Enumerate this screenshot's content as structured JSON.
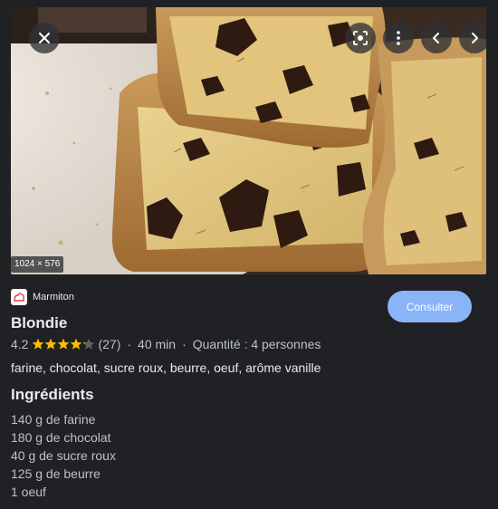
{
  "image": {
    "dimensions_label": "1024 × 576",
    "controls": {
      "close": "close-icon",
      "lens": "lens-search-icon",
      "more": "more-vertical-icon",
      "prev": "chevron-left-icon",
      "next": "chevron-right-icon"
    }
  },
  "source": {
    "name": "Marmiton",
    "logo": "marmiton-logo"
  },
  "consult_button": "Consulter",
  "recipe": {
    "title": "Blondie",
    "rating": "4.2",
    "rating_value": 4.2,
    "rating_max": 5,
    "reviews": "(27)",
    "separator": "·",
    "time": "40 min",
    "quantity": "Quantité : 4 personnes",
    "ingredients_summary": "farine, chocolat, sucre roux, beurre, oeuf, arôme vanille"
  },
  "ingredients_section": {
    "title": "Ingrédients",
    "items": [
      "140 g de farine",
      "180 g de chocolat",
      "40 g de sucre roux",
      "125 g de beurre",
      "1 oeuf"
    ]
  },
  "colors": {
    "background": "#202124",
    "accent_button": "#8ab4f8",
    "star": "#fbbc04",
    "star_empty": "#5f6368",
    "text_primary": "#e8eaed",
    "text_secondary": "#bdc1c6"
  }
}
